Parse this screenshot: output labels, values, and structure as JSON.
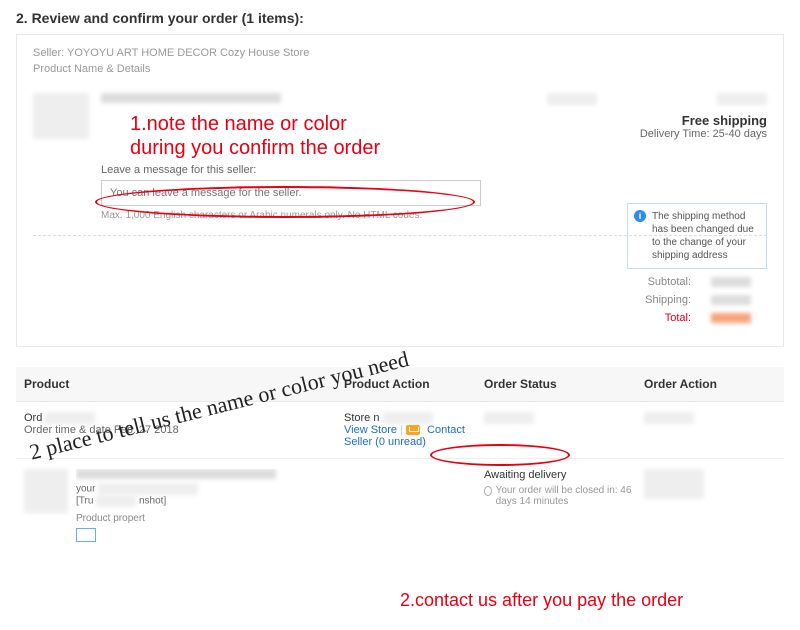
{
  "header": {
    "title": "2. Review and confirm your order (1 items):"
  },
  "order": {
    "seller_label": "Seller: YOYOYU ART HOME DECOR Cozy House Store",
    "details_label": "Product Name & Details",
    "free_ship": "Free shipping",
    "delivery_time": "Delivery Time: 25-40 days",
    "msg_label": "Leave a message for this seller:",
    "msg_placeholder": "You can leave a message for the seller.",
    "msg_hint": "Max. 1,000 English characters or Arabic numerals only. No HTML codes.",
    "notice": "The shipping method has been changed due to the change of your shipping address"
  },
  "totals": {
    "subtotal": "Subtotal:",
    "shipping": "Shipping:",
    "total": "Total:"
  },
  "table": {
    "h1": "Product",
    "h2": "Product Action",
    "h3": "Order Status",
    "h4": "Order Action",
    "order_prefix": "Ord",
    "order_date_line": "Order time & date             Feb. 27 2018",
    "store_prefix": "Store n",
    "view_store": "View Store",
    "contact_seller": "Contact Seller (0 unread)",
    "await": "Awaiting delivery",
    "closed": "Your order will be closed in: 46 days 14 minutes",
    "your": "your",
    "tru": "[Tru",
    "nshot": "nshot]",
    "prop": "Product propert"
  },
  "annotations": {
    "a1_l1": "1.note the name or color",
    "a1_l2": "during you confirm the order",
    "a2": "2.contact us after you pay the order",
    "script": "2 place to tell us the name or color you need"
  }
}
